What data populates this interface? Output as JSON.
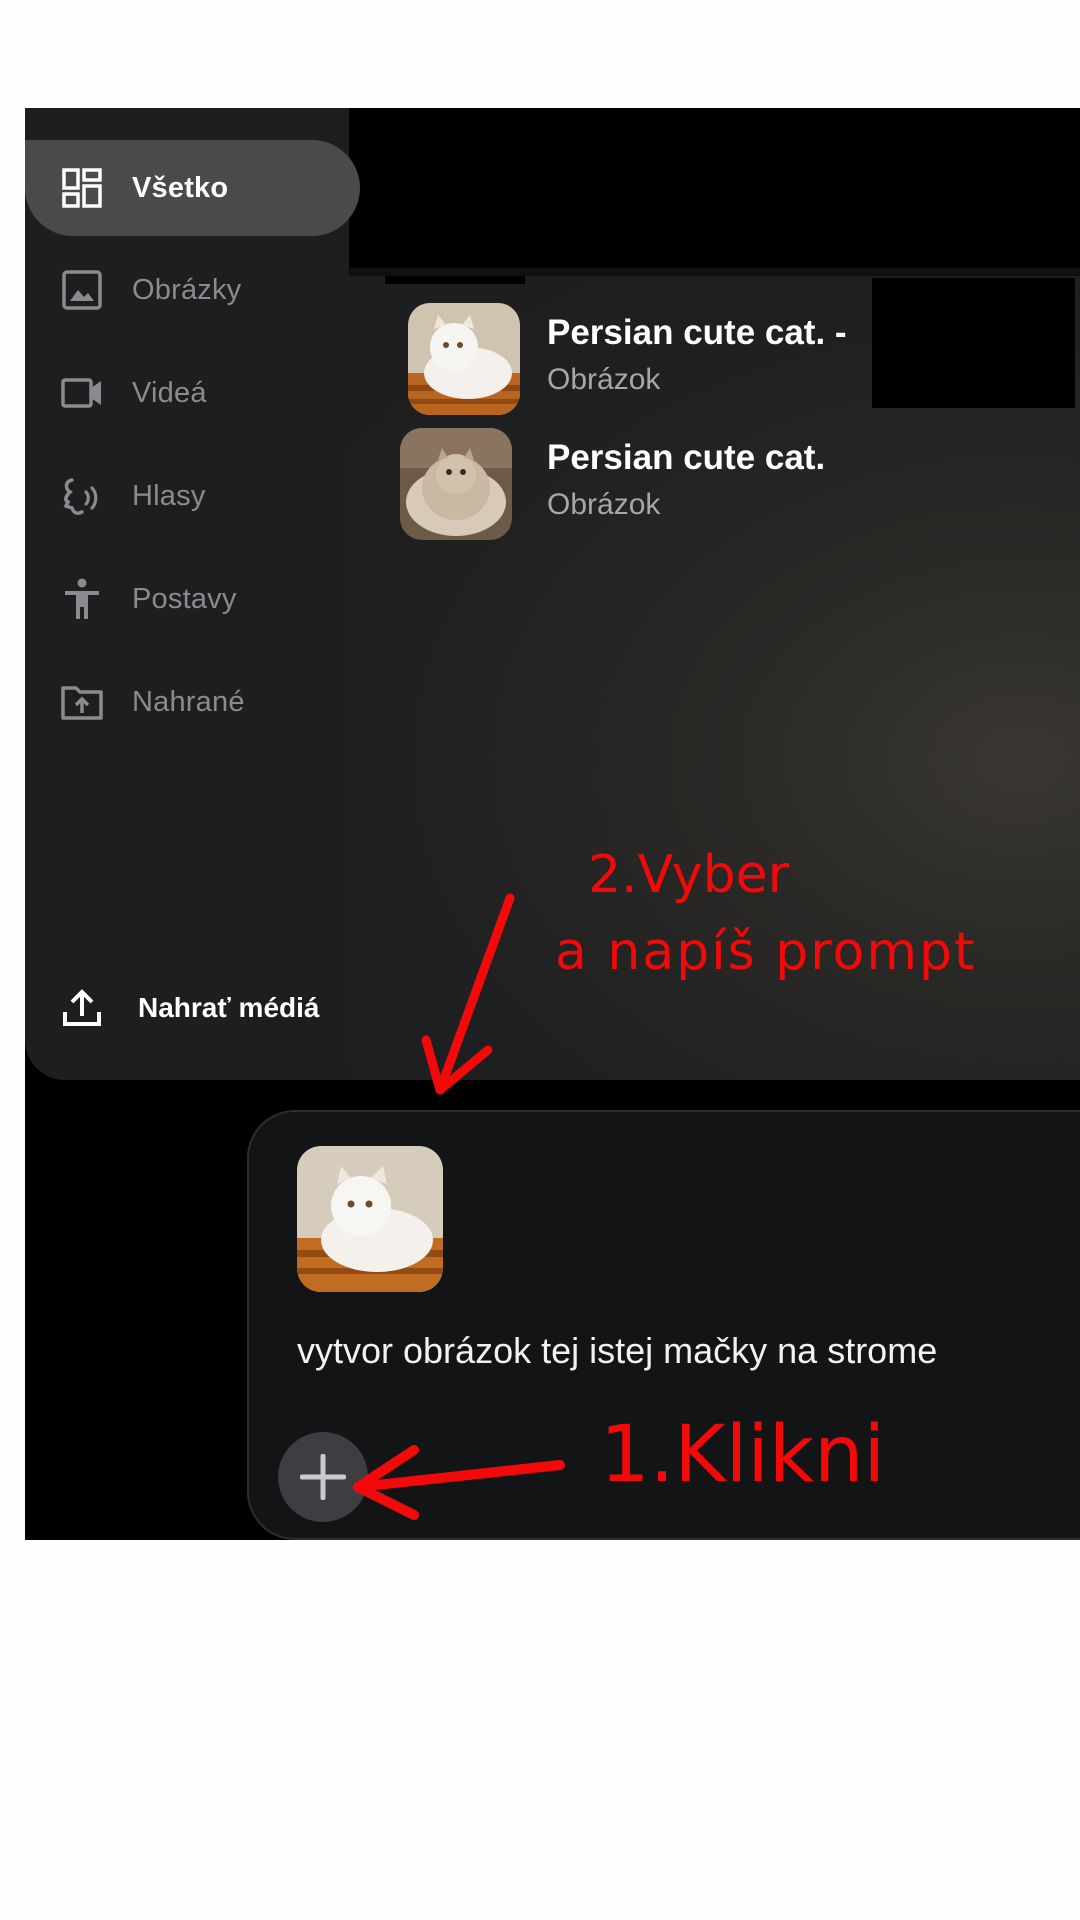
{
  "sidebar": {
    "items": [
      {
        "label": "Všetko",
        "icon": "dashboard-icon",
        "active": true
      },
      {
        "label": "Obrázky",
        "icon": "image-icon",
        "active": false
      },
      {
        "label": "Videá",
        "icon": "videocam-icon",
        "active": false
      },
      {
        "label": "Hlasy",
        "icon": "voice-icon",
        "active": false
      },
      {
        "label": "Postavy",
        "icon": "person-icon",
        "active": false
      },
      {
        "label": "Nahrané",
        "icon": "upload-folder-icon",
        "active": false
      }
    ],
    "upload_label": "Nahrať médiá",
    "upload_icon": "upload-icon"
  },
  "results": [
    {
      "title": "Persian cute cat. -",
      "subtitle": "Obrázok"
    },
    {
      "title": "Persian cute cat.",
      "subtitle": "Obrázok"
    }
  ],
  "composer": {
    "prompt": "vytvor obrázok tej istej mačky na strome",
    "add_icon": "plus-icon"
  },
  "annotations": {
    "step2_line1": "2.Vyber",
    "step2_line2": "a napíš prompt",
    "step1": "1.Klikni",
    "color": "#f20a0a"
  },
  "colors": {
    "panel_bg": "#1d1e20",
    "active_item_bg": "#4a4a4c",
    "composer_bg": "#131416",
    "muted_text": "#8a8b8e"
  }
}
